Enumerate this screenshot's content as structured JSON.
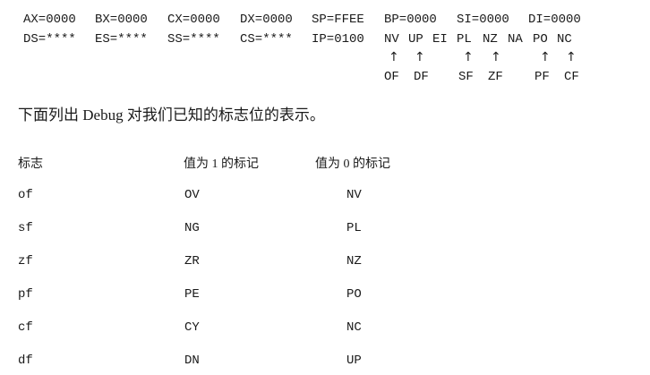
{
  "registers": {
    "row1": [
      "AX=0000",
      "BX=0000",
      "CX=0000",
      "DX=0000",
      "SP=FFEE",
      "BP=0000",
      "SI=0000",
      "DI=0000"
    ],
    "row2": [
      "DS=****",
      "ES=****",
      "SS=****",
      "CS=****",
      "IP=0100"
    ]
  },
  "flag_values": [
    "NV",
    "UP",
    "EI",
    "PL",
    "NZ",
    "NA",
    "PO",
    "NC"
  ],
  "arrow_glyph": "↑",
  "flag_names": [
    "OF",
    "DF",
    "SF",
    "ZF",
    "PF",
    "CF"
  ],
  "intro_text": "下面列出 Debug 对我们已知的标志位的表示。",
  "table": {
    "headers": [
      "标志",
      "值为 1 的标记",
      "值为 0 的标记"
    ],
    "rows": [
      {
        "flag": "of",
        "set": "OV",
        "clear": "NV"
      },
      {
        "flag": "sf",
        "set": "NG",
        "clear": "PL"
      },
      {
        "flag": "zf",
        "set": "ZR",
        "clear": "NZ"
      },
      {
        "flag": "pf",
        "set": "PE",
        "clear": "PO"
      },
      {
        "flag": "cf",
        "set": "CY",
        "clear": "NC"
      },
      {
        "flag": "df",
        "set": "DN",
        "clear": "UP"
      }
    ]
  }
}
